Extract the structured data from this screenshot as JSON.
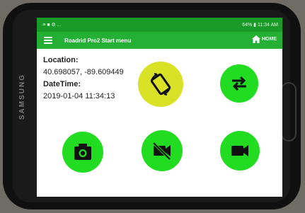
{
  "device": {
    "brand": "SAMSUNG"
  },
  "status_bar": {
    "left_icons": "·≡ ■ ⚙ ...",
    "right_text": "64% ▮ 11:34 AM"
  },
  "app_bar": {
    "title": "Roadrid Pro2 Start menu",
    "home_label": "HOME"
  },
  "info": {
    "location_label": "Location:",
    "location_value": "40.698057, -89.609449",
    "datetime_label": "DateTime:",
    "datetime_value": "2019-01-04 11:34:13"
  },
  "buttons": {
    "rotate": {
      "icon": "screen-rotation-icon",
      "color": "#d9e226"
    },
    "swap": {
      "icon": "swap-arrows-icon",
      "color": "#22dc22"
    },
    "camera": {
      "icon": "camera-icon",
      "color": "#22dc22"
    },
    "video_off": {
      "icon": "video-off-icon",
      "color": "#22dc22"
    },
    "video": {
      "icon": "video-camera-icon",
      "color": "#22dc22"
    }
  },
  "colors": {
    "status_bar": "#1a9b28",
    "app_bar": "#24b034",
    "accent_green": "#22dc22",
    "accent_yellow": "#d9e226"
  }
}
